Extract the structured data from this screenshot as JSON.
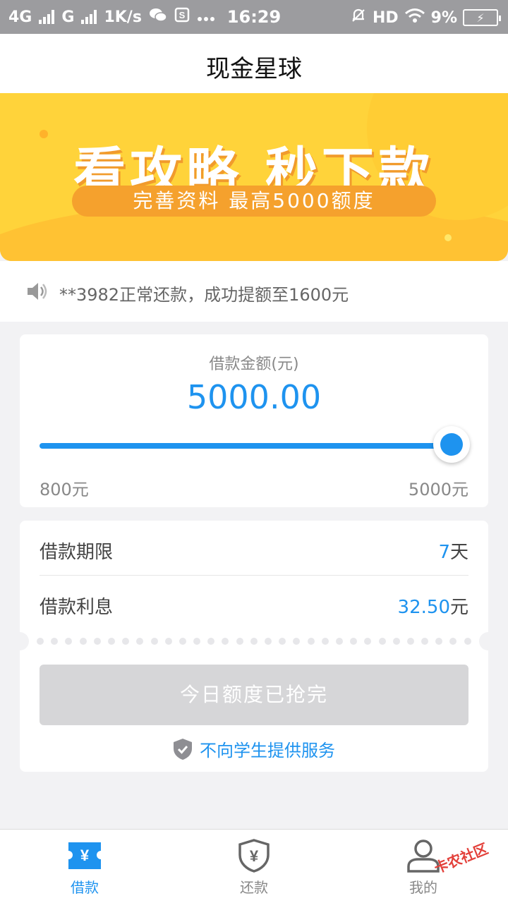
{
  "status_bar": {
    "network1": "4G",
    "network2": "G",
    "speed": "1K/s",
    "time": "16:29",
    "hd": "HD",
    "battery": "9%"
  },
  "header": {
    "title": "现金星球"
  },
  "banner": {
    "headline": "看攻略  秒下款",
    "subline": "完善资料  最高5000额度"
  },
  "notice": {
    "text": "**3982正常还款，成功提额至1600元"
  },
  "loan": {
    "amount_label": "借款金额(元)",
    "amount_value": "5000.00",
    "min_label": "800元",
    "max_label": "5000元",
    "slider_fraction": 1.0
  },
  "details": {
    "term_label": "借款期限",
    "term_value": "7",
    "term_unit": "天",
    "interest_label": "借款利息",
    "interest_value": "32.50",
    "interest_unit": "元",
    "button_label": "今日额度已抢完",
    "safety_text": "不向学生提供服务"
  },
  "bottom_nav": {
    "items": [
      {
        "label": "借款",
        "icon": "yen-ticket-icon",
        "active": true
      },
      {
        "label": "还款",
        "icon": "yen-shield-icon",
        "active": false
      },
      {
        "label": "我的",
        "icon": "person-icon",
        "active": false
      }
    ]
  },
  "watermark": {
    "text": "卡农社区"
  },
  "colors": {
    "accent": "#1e93ef",
    "banner_yellow": "#ffd33a",
    "button_disabled": "#d6d6d8"
  }
}
